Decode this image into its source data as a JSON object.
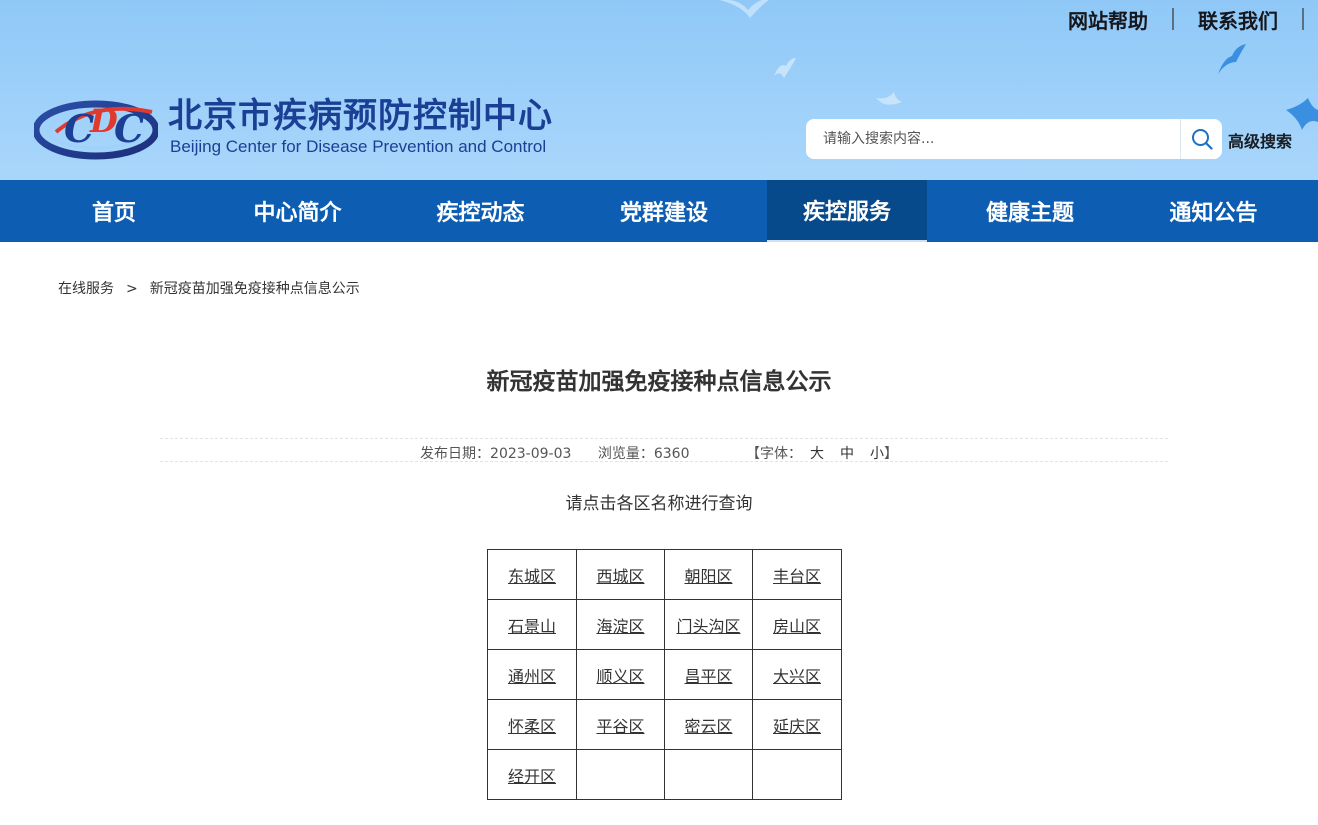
{
  "header": {
    "top_links": [
      "网站帮助",
      "联系我们"
    ],
    "brand_cn": "北京市疾病预防控制中心",
    "brand_en": "Beijing Center for Disease Prevention and Control",
    "search_placeholder": "请输入搜索内容...",
    "advanced_search": "高级搜索",
    "logo_icon": "cdc-logo-icon",
    "colors": {
      "sky": "#9fd1fa",
      "brand": "#1b3f95",
      "nav": "#0d5eb3",
      "nav_active": "#074a8c"
    }
  },
  "nav": {
    "items": [
      {
        "label": "首页"
      },
      {
        "label": "中心简介"
      },
      {
        "label": "疾控动态"
      },
      {
        "label": "党群建设"
      },
      {
        "label": "疾控服务",
        "active": true
      },
      {
        "label": "健康主题"
      },
      {
        "label": "通知公告"
      }
    ]
  },
  "breadcrumb": {
    "parent": "在线服务",
    "separator": ">",
    "current": "新冠疫苗加强免疫接种点信息公示"
  },
  "article": {
    "title": "新冠疫苗加强免疫接种点信息公示",
    "date_label": "发布日期：",
    "date": "2023-09-03",
    "views_label": "浏览量：",
    "views": "6360",
    "font_label": "【字体：",
    "font_sizes": [
      "大",
      "中",
      "小"
    ],
    "font_close": "】",
    "intro": "请点击各区名称进行查询"
  },
  "districts": {
    "rows": [
      [
        "东城区",
        "西城区",
        "朝阳区",
        "丰台区"
      ],
      [
        "石景山",
        "海淀区",
        "门头沟区",
        "房山区"
      ],
      [
        "通州区",
        "顺义区",
        "昌平区",
        "大兴区"
      ],
      [
        "怀柔区",
        "平谷区",
        "密云区",
        "延庆区"
      ],
      [
        "经开区",
        "",
        "",
        ""
      ]
    ]
  }
}
